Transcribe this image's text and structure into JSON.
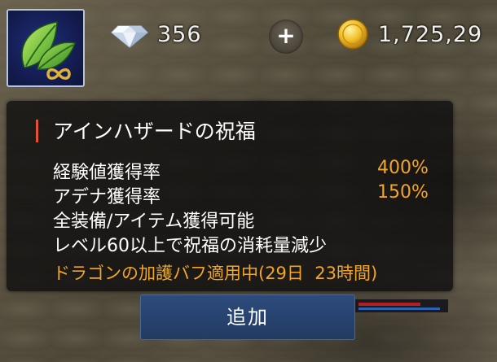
{
  "top_bar": {
    "gem_count": "356",
    "plus_label": "+",
    "gold_amount": "1,725,29"
  },
  "tooltip": {
    "title": "アインハザードの祝福",
    "rows": [
      {
        "label": "経験値獲得率",
        "value": "400%"
      },
      {
        "label": "アデナ獲得率",
        "value": "150%"
      },
      {
        "label": "全装備/アイテム獲得可能",
        "value": ""
      },
      {
        "label": "レベル60以上で祝福の消耗量減少",
        "value": ""
      }
    ],
    "buff_status": "ドラゴンの加護バフ適用中(29日  23時間)"
  },
  "add_button": {
    "label": "追加"
  },
  "colors": {
    "accent_orange": "#f2a623",
    "title_marker": "#e2522e",
    "button_blue": "#2d4b7c",
    "icon_bg": "#1a2566"
  },
  "icons": {
    "item": "green-leaves-infinity-icon",
    "gem": "diamond-icon",
    "gold": "gold-coin-icon"
  }
}
